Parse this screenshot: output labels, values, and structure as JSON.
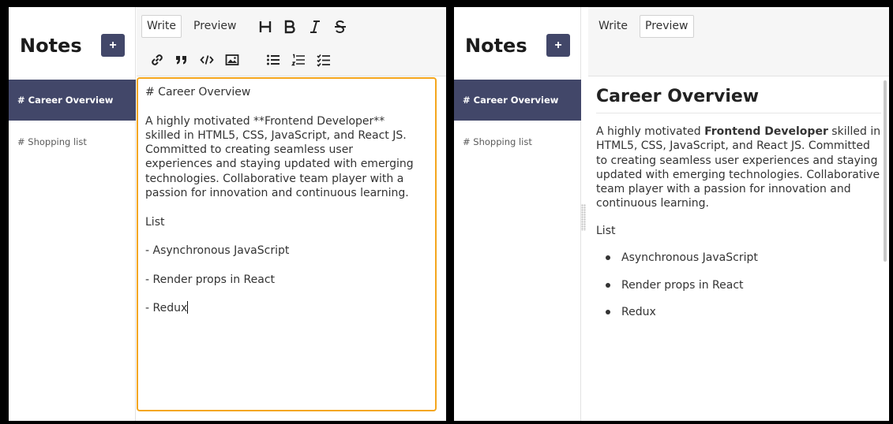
{
  "left": {
    "sidebar": {
      "title": "Notes",
      "add_label": "+",
      "notes": [
        {
          "label": "# Career Overview"
        },
        {
          "label": "# Shopping list"
        }
      ]
    },
    "toolbar": {
      "tabs": [
        {
          "label": "Write"
        },
        {
          "label": "Preview"
        }
      ],
      "tool_icons": [
        "heading-icon",
        "bold-icon",
        "italic-icon",
        "strikethrough-icon",
        "link-icon",
        "quote-icon",
        "code-icon",
        "image-icon",
        "unordered-list-icon",
        "ordered-list-icon",
        "checklist-icon"
      ]
    },
    "editor_text": "# Career Overview\n\nA highly motivated **Frontend Developer**\nskilled in HTML5, CSS, JavaScript, and React JS.\nCommitted to creating seamless user\nexperiences and staying updated with emerging\ntechnologies. Collaborative team player with a\npassion for innovation and continuous learning.\n\nList\n\n- Asynchronous JavaScript\n\n- Render props in React\n\n- Redux"
  },
  "right": {
    "sidebar": {
      "title": "Notes",
      "add_label": "+",
      "notes": [
        {
          "label": "# Career Overview"
        },
        {
          "label": "# Shopping list"
        }
      ]
    },
    "toolbar": {
      "tabs": [
        {
          "label": "Write"
        },
        {
          "label": "Preview"
        }
      ]
    },
    "preview": {
      "heading": "Career Overview",
      "para_prefix": "A highly motivated ",
      "para_bold": "Frontend Developer",
      "para_suffix": " skilled in HTML5, CSS, JavaScript, and React JS. Committed to creating seamless user experiences and staying updated with emerging technologies. Collaborative team player with a passion for innovation and continuous learning.",
      "list_title": "List",
      "items": [
        "Asynchronous JavaScript",
        "Render props in React",
        "Redux"
      ]
    }
  },
  "colors": {
    "active_note_bg": "#424769",
    "focus_border": "#f4a61d"
  }
}
